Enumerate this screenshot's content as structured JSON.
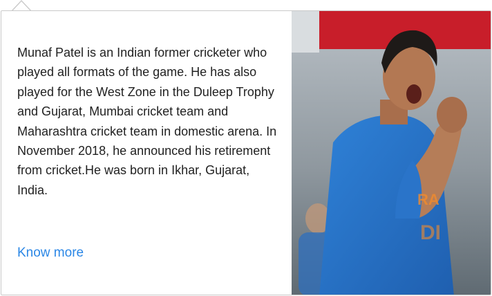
{
  "card": {
    "bio": "Munaf Patel is an Indian former cricketer who played all formats of the game. He has also played for the West Zone in the Duleep Trophy and Gujarat, Mumbai cricket team and Maharashtra cricket team in domestic arena. In November 2018, he announced his retirement from cricket.He was born in Ikhar, Gujarat, India.",
    "link_label": "Know more"
  },
  "colors": {
    "link": "#2b87e6",
    "jersey": "#2a74c9",
    "backdrop_red": "#c81e2a"
  }
}
